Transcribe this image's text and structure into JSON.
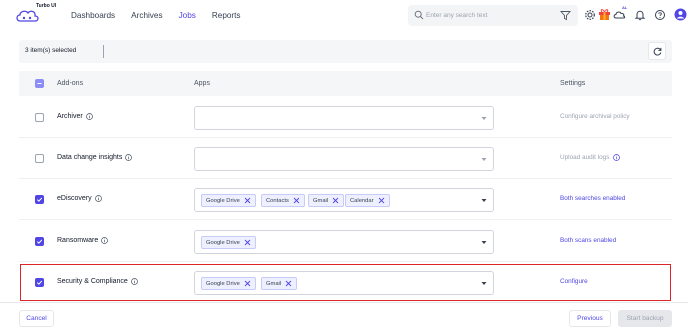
{
  "app": {
    "logo_text": "Turbo UI"
  },
  "nav": {
    "items": [
      {
        "label": "Dashboards",
        "active": false
      },
      {
        "label": "Archives",
        "active": false
      },
      {
        "label": "Jobs",
        "active": true
      },
      {
        "label": "Reports",
        "active": false
      }
    ]
  },
  "search": {
    "placeholder": "Enter any search text"
  },
  "header_icons": [
    "filter-icon",
    "settings-icon",
    "gift-icon",
    "weather-icon",
    "bell-icon",
    "help-icon",
    "user-icon"
  ],
  "weather_badge": "AL",
  "selection": {
    "text": "3 item(s) selected"
  },
  "table": {
    "headers": {
      "addons": "Add-ons",
      "apps": "Apps",
      "settings": "Settings"
    },
    "rows": [
      {
        "name": "Archiver",
        "checked": false,
        "chips": [],
        "setting": "Configure archival policy",
        "setting_muted": true,
        "setting_icon": false
      },
      {
        "name": "Data change insights",
        "checked": false,
        "chips": [],
        "setting": "Upload audit logs",
        "setting_muted": true,
        "setting_icon": true
      },
      {
        "name": "eDiscovery",
        "checked": true,
        "chips": [
          "Google Drive",
          "Contacts",
          "Gmail",
          "Calendar"
        ],
        "setting": "Both searches enabled",
        "setting_muted": false,
        "setting_icon": false
      },
      {
        "name": "Ransomware",
        "checked": true,
        "chips": [
          "Google Drive"
        ],
        "setting": "Both scans enabled",
        "setting_muted": false,
        "setting_icon": false
      },
      {
        "name": "Security & Compliance",
        "checked": true,
        "chips": [
          "Google Drive",
          "Gmail"
        ],
        "setting": "Configure",
        "setting_muted": false,
        "setting_icon": false
      }
    ]
  },
  "footer": {
    "cancel": "Cancel",
    "previous": "Previous",
    "start": "Start backup"
  },
  "colors": {
    "accent": "#4f46e5",
    "highlight": "#dc2626",
    "muted": "#9ca3af"
  }
}
